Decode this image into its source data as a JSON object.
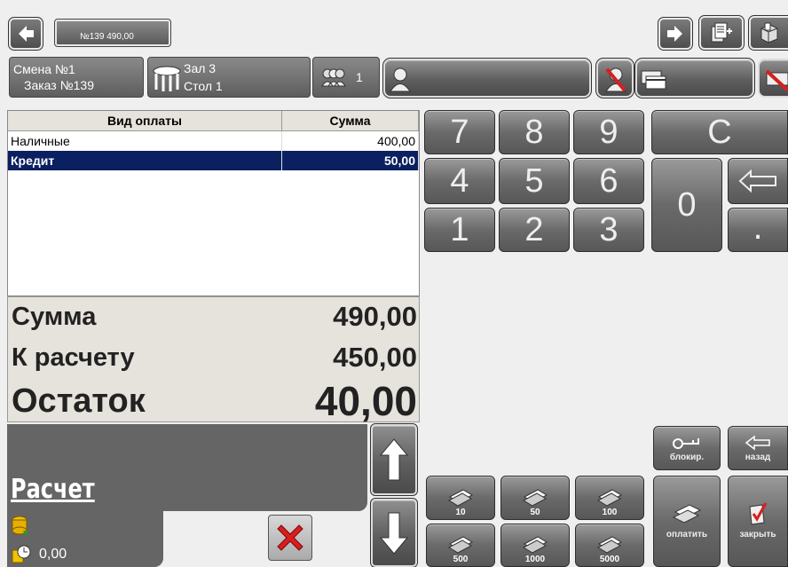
{
  "top_bar": {
    "order_label": "№139  490,00"
  },
  "info_bar": {
    "shift_label": "Смена №1",
    "order_label": "Заказ №139",
    "hall_label": "Зал 3",
    "table_label": "Стол 1",
    "guests_count": "1"
  },
  "payment_table": {
    "headers": [
      "Вид оплаты",
      "Сумма"
    ],
    "rows": [
      {
        "type": "Наличные",
        "amount": "400,00"
      },
      {
        "type": "Кредит",
        "amount": "50,00"
      }
    ]
  },
  "totals": {
    "sum_label": "Сумма",
    "sum_value": "490,00",
    "due_label": "К расчету",
    "due_value": "450,00",
    "rest_label": "Остаток",
    "rest_value": "40,00"
  },
  "settle_label": "Расчет",
  "balance_value": "0,00",
  "keypad": {
    "keys": [
      "7",
      "8",
      "9",
      "4",
      "5",
      "6",
      "1",
      "2",
      "3"
    ],
    "clear": "C",
    "zero": "0",
    "dot": "."
  },
  "money_buttons": [
    "10",
    "50",
    "100",
    "500",
    "1000",
    "5000"
  ],
  "action_buttons": {
    "block": "блокир.",
    "back": "назад",
    "pay": "оплатить",
    "close": "закрыть"
  },
  "colors": {
    "selected_row": "#0a2060",
    "button_gray": "#6a6a6a",
    "cancel_red": "#d42020"
  }
}
